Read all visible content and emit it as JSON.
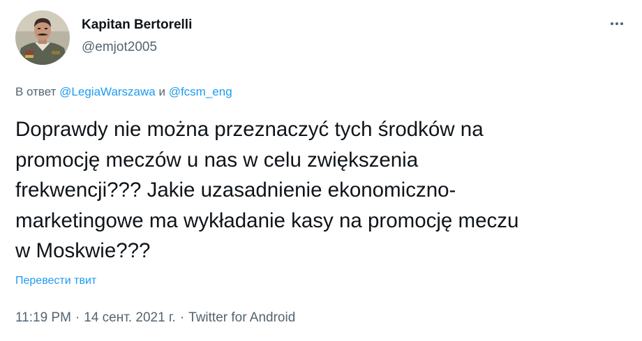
{
  "author": {
    "display_name": "Kapitan Bertorelli",
    "handle": "@emjot2005"
  },
  "reply": {
    "prefix": "В ответ ",
    "mention_1": "@LegiaWarszawa",
    "joiner": " и ",
    "mention_2": "@fcsm_eng"
  },
  "tweet": {
    "text": "Doprawdy nie można przeznaczyć tych środków na\npromocję meczów u nas w celu zwiększenia\nfrekwencji??? Jakie uzasadnienie ekonomiczno-\nmarketingowe ma wykładanie kasy na promocję meczu\nw Moskwie???"
  },
  "translate_label": "Перевести твит",
  "meta": {
    "time": "11:19 PM",
    "separator": "·",
    "date": "14 сент. 2021 г.",
    "source": "Twitter for Android"
  },
  "icons": {
    "more": "more-horizontal-icon"
  },
  "colors": {
    "accent": "#1d9bf0",
    "text_primary": "#0f1419",
    "text_secondary": "#536471"
  }
}
